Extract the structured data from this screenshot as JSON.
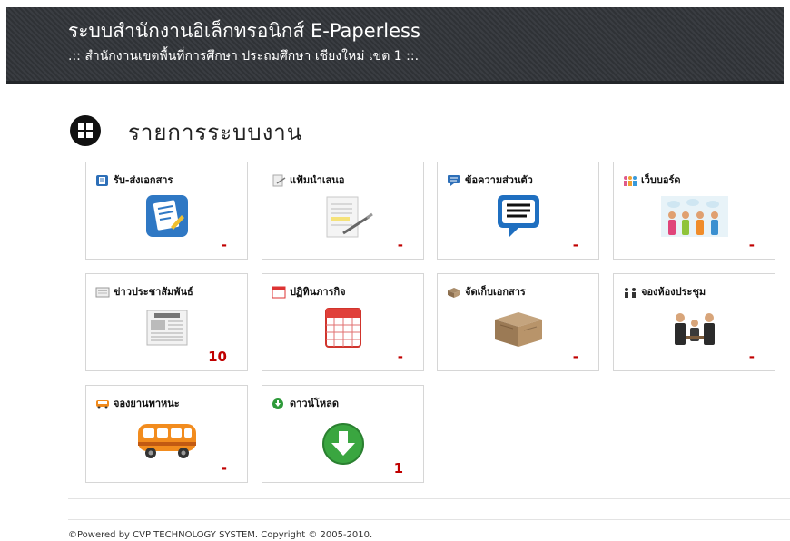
{
  "header": {
    "title": "ระบบสำนักงานอิเล็กทรอนิกส์ E-Paperless",
    "subtitle": ".:: สำนักงานเขตพื้นที่การศึกษา ประถมศึกษา เชียงใหม่ เขต 1 ::."
  },
  "section": {
    "title": "รายการระบบงาน",
    "icon": "grid-icon"
  },
  "tiles": [
    {
      "label": "รับ-ส่งเอกสาร",
      "count": "-",
      "icon": "document-edit-icon"
    },
    {
      "label": "แฟ้มนำเสนอ",
      "count": "-",
      "icon": "document-sign-icon"
    },
    {
      "label": "ข้อความส่วนตัว",
      "count": "-",
      "icon": "speech-bubble-icon"
    },
    {
      "label": "เว็บบอร์ด",
      "count": "-",
      "icon": "people-board-icon"
    },
    {
      "label": "ข่าวประชาสัมพันธ์",
      "count": "10",
      "icon": "newspaper-icon"
    },
    {
      "label": "ปฏิทินภารกิจ",
      "count": "-",
      "icon": "calendar-icon"
    },
    {
      "label": "จัดเก็บเอกสาร",
      "count": "-",
      "icon": "archive-box-icon"
    },
    {
      "label": "จองห้องประชุม",
      "count": "-",
      "icon": "meeting-icon"
    },
    {
      "label": "จองยานพาหนะ",
      "count": "-",
      "icon": "bus-icon"
    },
    {
      "label": "ดาวน์โหลด",
      "count": "1",
      "icon": "download-icon"
    }
  ],
  "footer": {
    "text": "©Powered by CVP TECHNOLOGY SYSTEM. Copyright © 2005-2010."
  },
  "colors": {
    "header_bg": "#34373c",
    "count_red": "#c00000",
    "tile_border": "#d6d6d6"
  }
}
